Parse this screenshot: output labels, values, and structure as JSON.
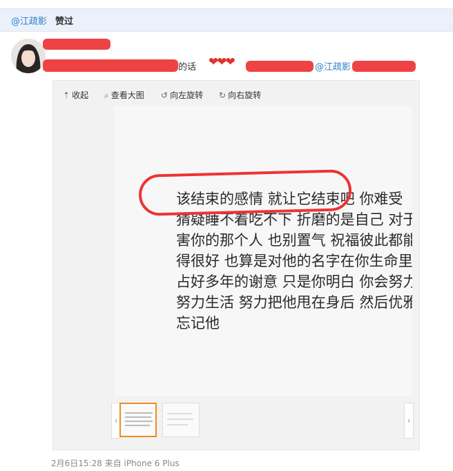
{
  "header": {
    "user": "@江疏影",
    "action": "赞过"
  },
  "post": {
    "text_fragment": "的话",
    "hearts": "❤❤❤",
    "mention": "@江疏影"
  },
  "toolbar": {
    "collapse": "收起",
    "view_large": "查看大图",
    "rotate_left": "向左旋转",
    "rotate_right": "向右旋转"
  },
  "image_text": [
    "该结束的感情  就让它结束吧  你难受",
    "猜疑睡不着吃不下  折磨的是自己  对于伤",
    "害你的那个人  也别置气  祝福彼此都能过",
    "得很好  也算是对他的名字在你生命里霸",
    "占好多年的谢意  只是你明白  你会努力笑",
    "努力生活  努力把他甩在身后  然后优雅地",
    "忘记他"
  ],
  "footer": "2月6日15:28 来自 iPhone 6 Plus",
  "colors": {
    "link": "#2c7fca",
    "redaction": "#ee3333",
    "thumb_active": "#f08a24"
  }
}
